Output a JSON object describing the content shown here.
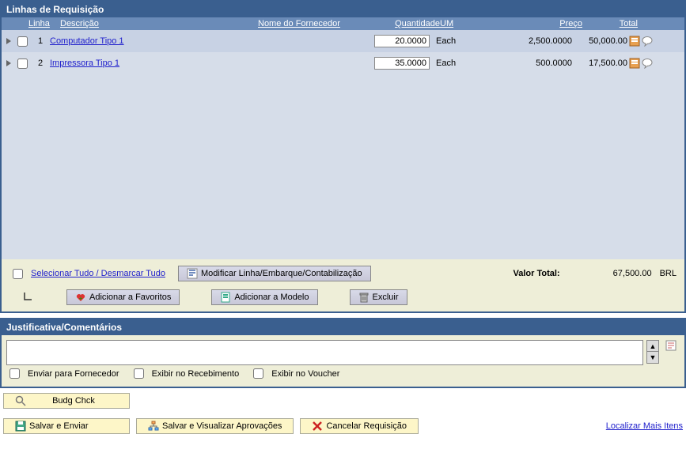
{
  "header": {
    "title": "Linhas de Requisição"
  },
  "columns": {
    "linha": "Linha",
    "descricao": "Descrição",
    "fornecedor": "Nome do Fornecedor",
    "quantidade": "Quantidade",
    "um": "UM",
    "preco": "Preço",
    "total": "Total"
  },
  "lines": [
    {
      "num": "1",
      "desc": "Computador Tipo 1",
      "qty": "20.0000",
      "um": "Each",
      "price": "2,500.0000",
      "total": "50,000.00"
    },
    {
      "num": "2",
      "desc": "Impressora Tipo 1",
      "qty": "35.0000",
      "um": "Each",
      "price": "500.0000",
      "total": "17,500.00"
    }
  ],
  "footer": {
    "select_all": "Selecionar Tudo / Desmarcar Tudo",
    "modify_line": "Modificar Linha/Embarque/Contabilização",
    "total_label": "Valor Total:",
    "total_value": "67,500.00",
    "currency": "BRL",
    "add_fav": "Adicionar a Favoritos",
    "add_model": "Adicionar a Modelo",
    "delete": "Excluir"
  },
  "comments": {
    "header": "Justificativa/Comentários",
    "send_supplier": "Enviar para Fornecedor",
    "show_receipt": "Exibir no Recebimento",
    "show_voucher": "Exibir no Voucher"
  },
  "actions": {
    "budg_check": "Budg Chck",
    "save_send": "Salvar e Enviar",
    "save_preview": "Salvar e Visualizar Aprovações",
    "cancel": "Cancelar Requisição",
    "find_more": "Localizar Mais Itens"
  }
}
